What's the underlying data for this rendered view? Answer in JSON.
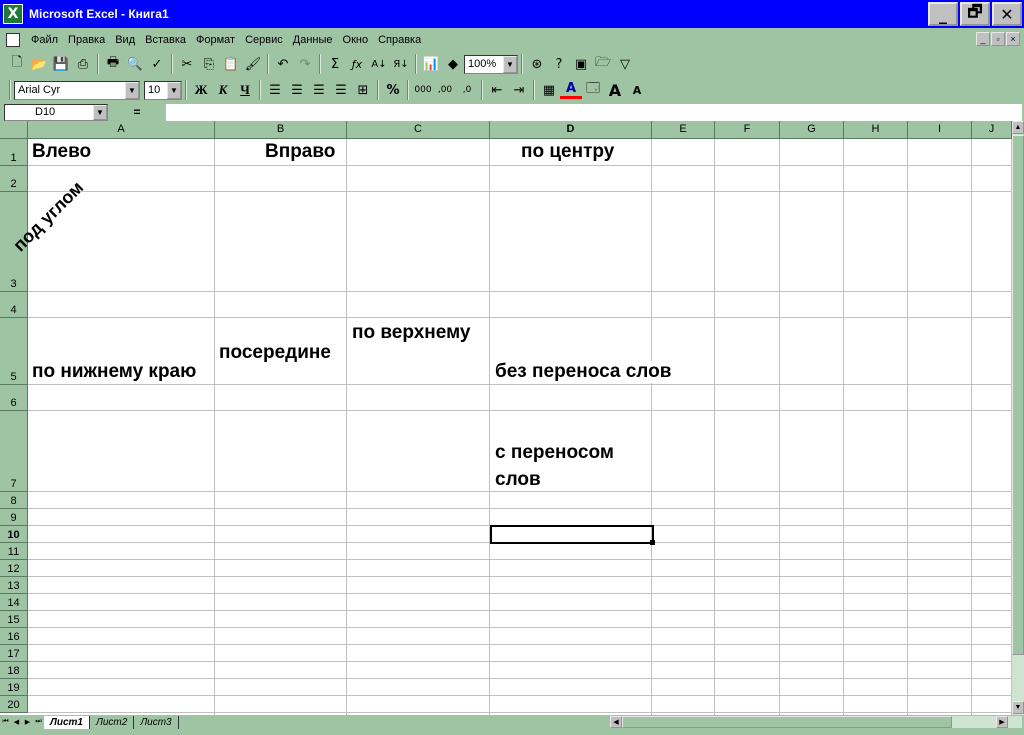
{
  "window": {
    "title": "Microsoft Excel - Книга1",
    "app_icon": "X",
    "minimize": "_",
    "restore": "🗗",
    "close": "✕"
  },
  "menu": {
    "items": [
      {
        "u": "Ф",
        "rest": "айл"
      },
      {
        "u": "П",
        "rest": "равка"
      },
      {
        "u": "В",
        "rest": "ид"
      },
      {
        "u": "",
        "pre": "Вст",
        "mid": "а",
        "rest": "вка"
      },
      {
        "u": "",
        "pre": "Фор",
        "mid": "м",
        "rest": "ат"
      },
      {
        "u": "",
        "pre": "",
        "mid": "С",
        "rest": "ервис"
      },
      {
        "u": "Д",
        "rest": "анные"
      },
      {
        "u": "О",
        "rest": "кно"
      },
      {
        "u": "",
        "pre": "",
        "mid": "С",
        "rest": "правка"
      }
    ],
    "labels": [
      "Файл",
      "Правка",
      "Вид",
      "Вставка",
      "Формат",
      "Сервис",
      "Данные",
      "Окно",
      "Справка"
    ]
  },
  "toolbar": {
    "zoom": "100%",
    "font_name": "Arial Cyr",
    "font_size": "10",
    "bold": "Ж",
    "italic": "К",
    "underline": "Ч",
    "percent": "%",
    "thousands": "000",
    "increase_decimal": "⁺⁰",
    "decrease_decimal": "⁻⁰",
    "sum": "Σ",
    "fx": "ƒx"
  },
  "formula_bar": {
    "name_box": "D10",
    "equals": "=",
    "value": ""
  },
  "columns": [
    "A",
    "B",
    "C",
    "D",
    "E",
    "F",
    "G",
    "H",
    "I",
    "J"
  ],
  "active_column": "D",
  "rows": [
    "1",
    "2",
    "3",
    "4",
    "5",
    "6",
    "7",
    "8",
    "9",
    "10",
    "11",
    "12",
    "13",
    "14",
    "15",
    "16",
    "17",
    "18",
    "19",
    "20"
  ],
  "active_row": "10",
  "cells": {
    "A1": "Влево",
    "B1": "Вправо",
    "D1": "по центру",
    "A3": "под углом",
    "A5": "по нижнему краю",
    "B5": "посередине",
    "C5": "по верхнему",
    "D5": "без переноса слов",
    "D7_line1": "с переносом",
    "D7_line2": "слов"
  },
  "sheets": [
    "Лист1",
    "Лист2",
    "Лист3"
  ],
  "active_sheet": "Лист1"
}
